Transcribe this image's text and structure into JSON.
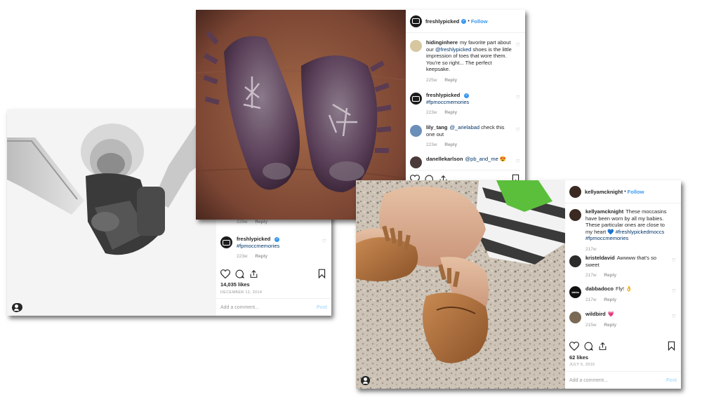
{
  "post1": {
    "comments": [
      {
        "time": "229w",
        "reply": "Reply"
      },
      {
        "user": "freshlypicked",
        "tag": "#fpmoccmemories",
        "time": "223w",
        "reply": "Reply"
      }
    ],
    "likes": "14,035 likes",
    "date": "DECEMBER 12, 2014",
    "add_comment": "Add a comment...",
    "post_label": "Post"
  },
  "post2": {
    "user": "freshlypicked",
    "follow": "Follow",
    "comments": [
      {
        "user": "hidinginhere",
        "pre": "my favorite part about our ",
        "tag": "@freshlypicked",
        "post": " shoes is the little impression of toes that wore them. You're so right... The perfect keepsake.",
        "time": "225w",
        "reply": "Reply"
      },
      {
        "user": "freshlypicked",
        "tag": "#fpmoccmemories",
        "time": "223w",
        "reply": "Reply"
      },
      {
        "user": "lily_tang",
        "tag": "@_arielabad",
        "post": " check this one out",
        "time": "223w",
        "reply": "Reply"
      },
      {
        "user": "danellekarlson",
        "tag": "@pb_and_me",
        "post": " 😍"
      }
    ]
  },
  "post3": {
    "user": "kellyamcknight",
    "follow": "Follow",
    "comments": [
      {
        "user": "kellyamcknight",
        "text": "These moccasins have been worn by all my babies. These particular ones are close to my heart 💙 ",
        "tag1": "#freshlypickedmoccs",
        "tag2": "#fpmoccmemories",
        "time": "217w"
      },
      {
        "user": "kristeldavid",
        "text": "Awwww that's so sweet",
        "time": "217w",
        "reply": "Reply"
      },
      {
        "user": "dabbadoco",
        "text": "Fly! 👌",
        "time": "217w",
        "reply": "Reply",
        "avatar_text": "dabba"
      },
      {
        "user": "wildbird",
        "text": "💗",
        "time": "215w",
        "reply": "Reply"
      }
    ],
    "likes": "62 likes",
    "date": "JULY 5, 2015",
    "add_comment": "Add a comment...",
    "post_label": "Post"
  }
}
